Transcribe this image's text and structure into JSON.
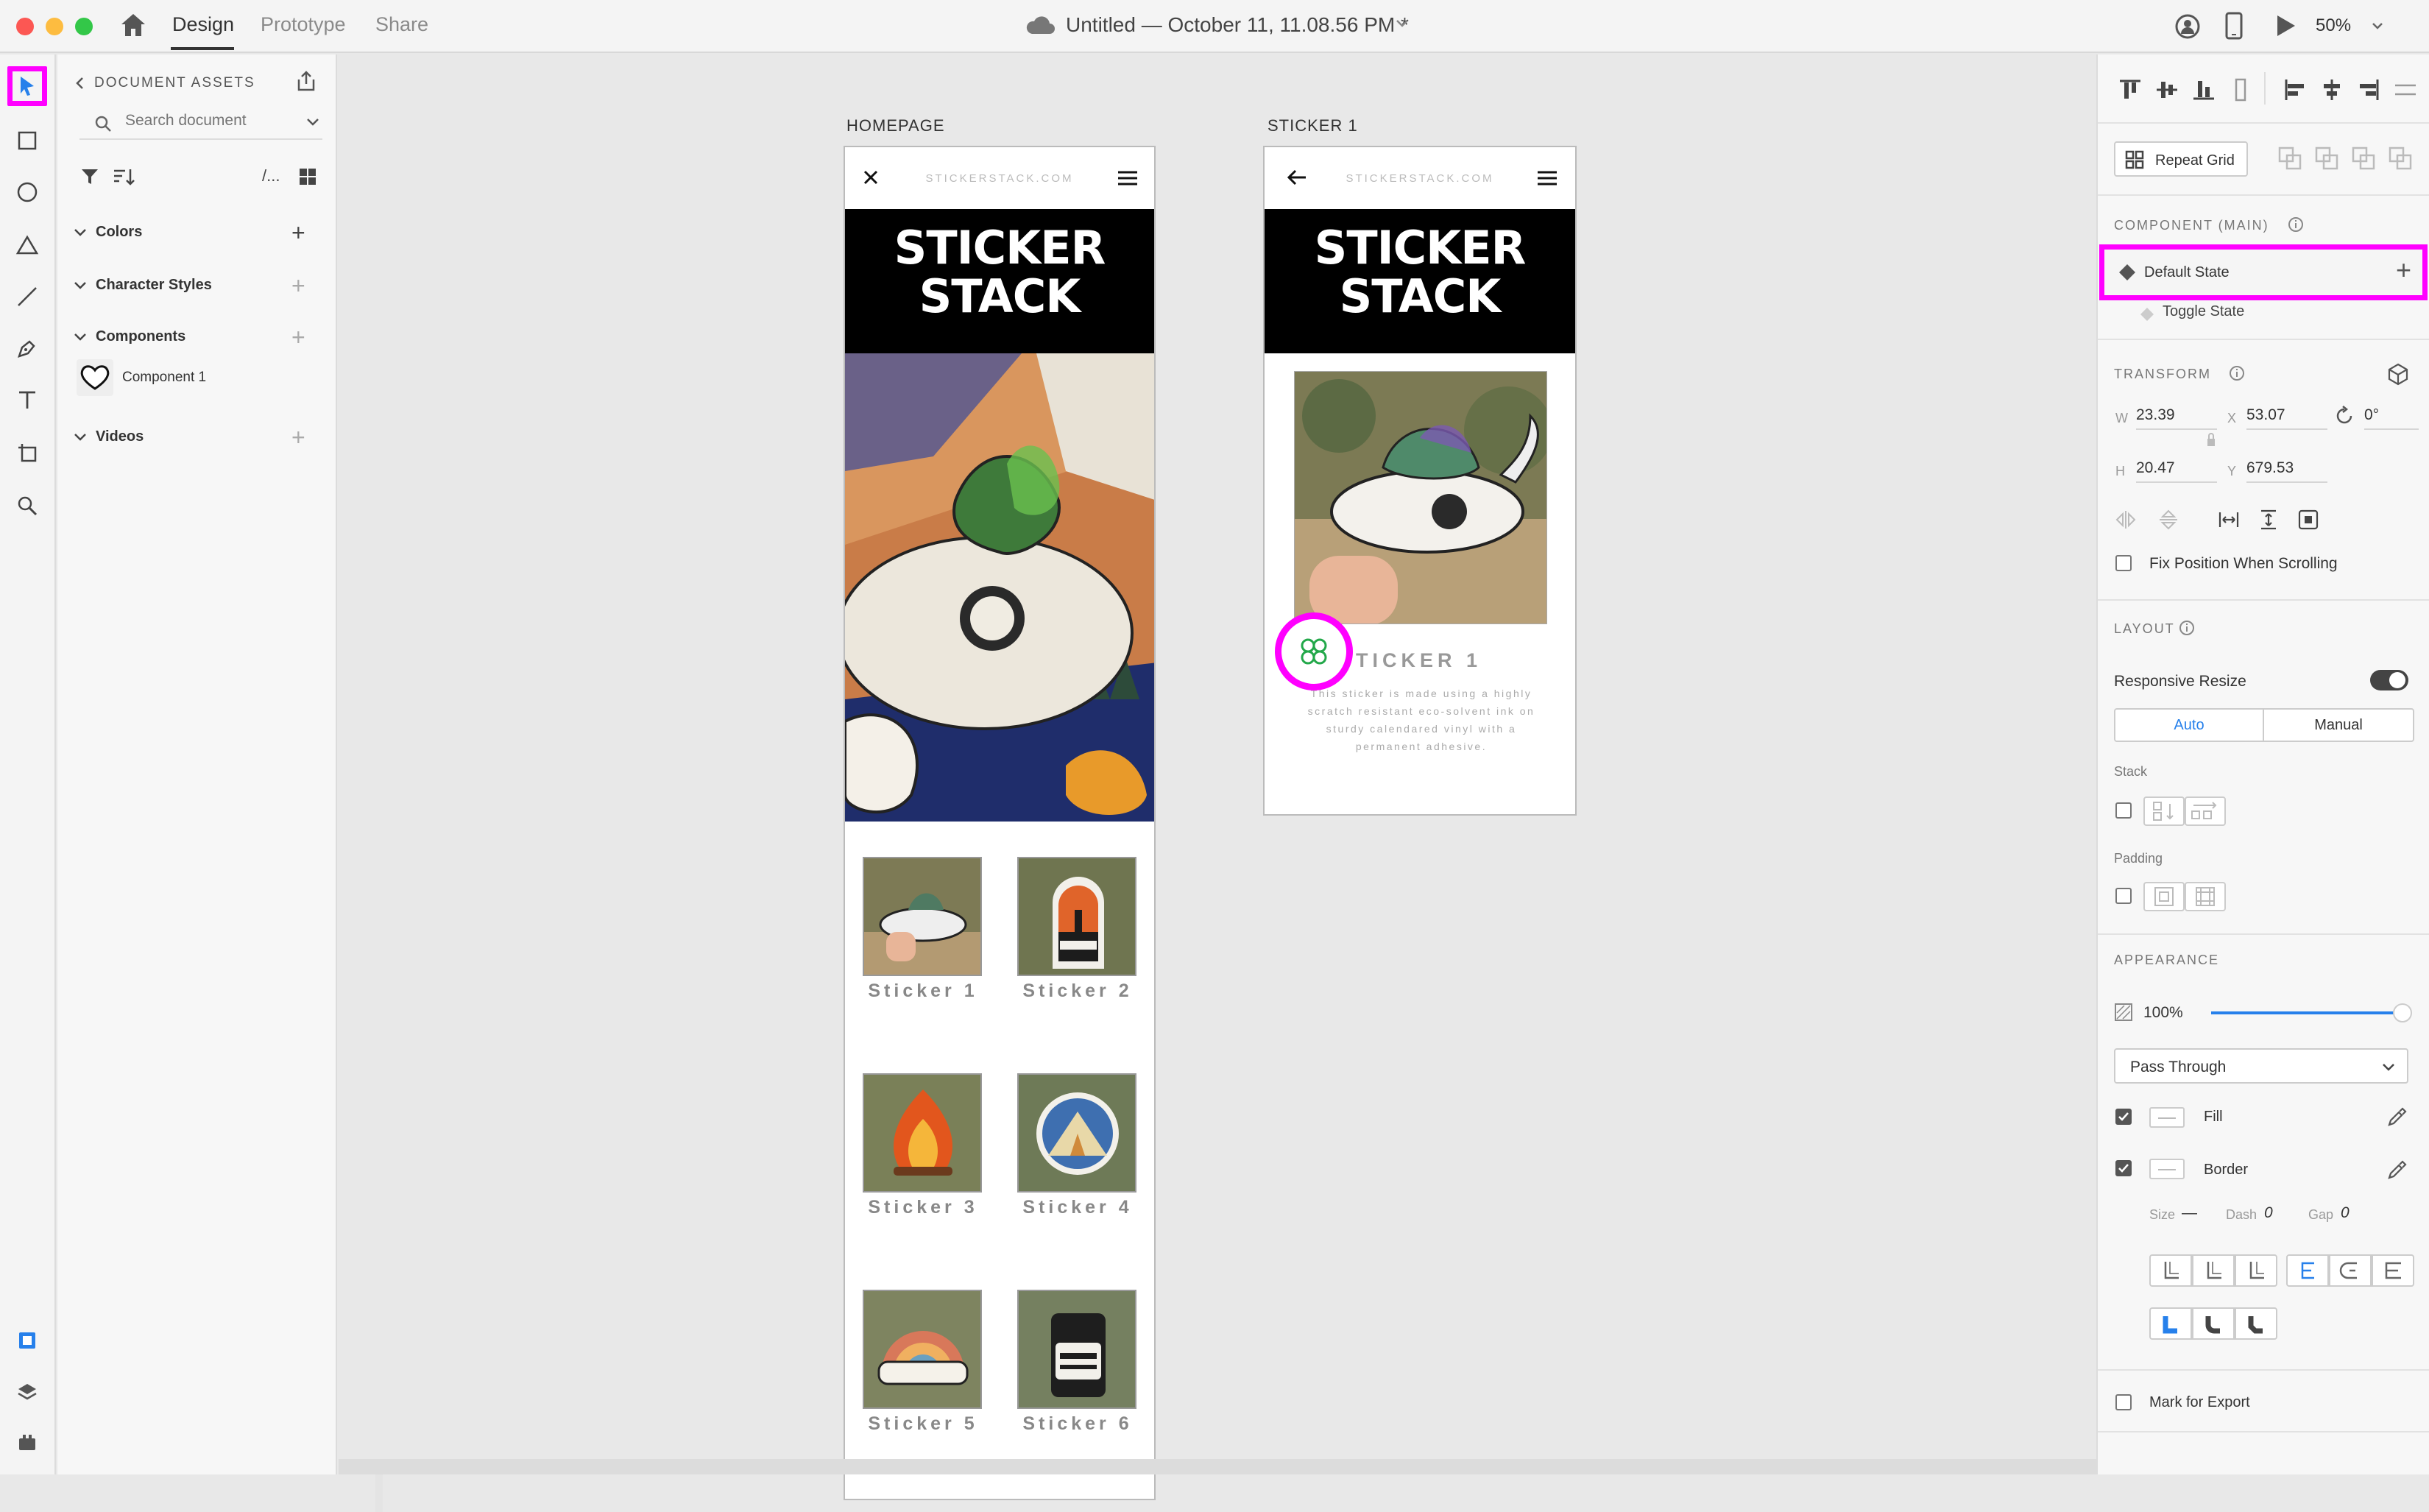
{
  "titlebar": {
    "tabs": [
      "Design",
      "Prototype",
      "Share"
    ],
    "document_title": "Untitled — October 11, 11.08.56 PM *",
    "zoom": "50%"
  },
  "assets_panel": {
    "header": "DOCUMENT ASSETS",
    "search_placeholder": "Search document",
    "filter_label": "/...",
    "sections": {
      "colors": "Colors",
      "character_styles": "Character Styles",
      "components": "Components",
      "videos": "Videos"
    },
    "component_item": "Component 1"
  },
  "artboards": {
    "homepage": {
      "label": "HOMEPAGE",
      "url": "STICKERSTACK.COM",
      "banner_line1": "STICKER",
      "banner_line2": "STACK",
      "stickers": [
        "Sticker 1",
        "Sticker 2",
        "Sticker 3",
        "Sticker 4",
        "Sticker 5",
        "Sticker 6"
      ]
    },
    "sticker1": {
      "label": "STICKER 1",
      "url": "STICKERSTACK.COM",
      "banner_line1": "STICKER",
      "banner_line2": "STACK",
      "title": "STICKER 1",
      "desc_line1": "This sticker is made using a highly",
      "desc_line2": "scratch resistant eco-solvent ink on",
      "desc_line3": "sturdy calendared vinyl with a",
      "desc_line4": "permanent adhesive."
    }
  },
  "properties": {
    "repeat_grid": "Repeat Grid",
    "component_heading": "COMPONENT (MAIN)",
    "states": [
      "Default State",
      "Toggle State"
    ],
    "transform_heading": "TRANSFORM",
    "w_label": "W",
    "w": "23.39",
    "x_label": "X",
    "x": "53.07",
    "h_label": "H",
    "h": "20.47",
    "y_label": "Y",
    "y": "679.53",
    "rotation": "0°",
    "fix_position": "Fix Position When Scrolling",
    "layout_heading": "LAYOUT",
    "responsive_resize": "Responsive Resize",
    "auto": "Auto",
    "manual": "Manual",
    "stack": "Stack",
    "padding": "Padding",
    "appearance_heading": "APPEARANCE",
    "opacity": "100%",
    "opacity_level": 1.0,
    "blend_mode": "Pass Through",
    "fill": "Fill",
    "border": "Border",
    "size_label": "Size",
    "size_value": "—",
    "dash_label": "Dash",
    "dash_value": "0",
    "gap_label": "Gap",
    "gap_value": "0",
    "mark_for_export": "Mark for Export"
  },
  "colors": {
    "highlight": "#ff00ff",
    "accent": "#2680eb",
    "component_icon": "#23a84a"
  }
}
